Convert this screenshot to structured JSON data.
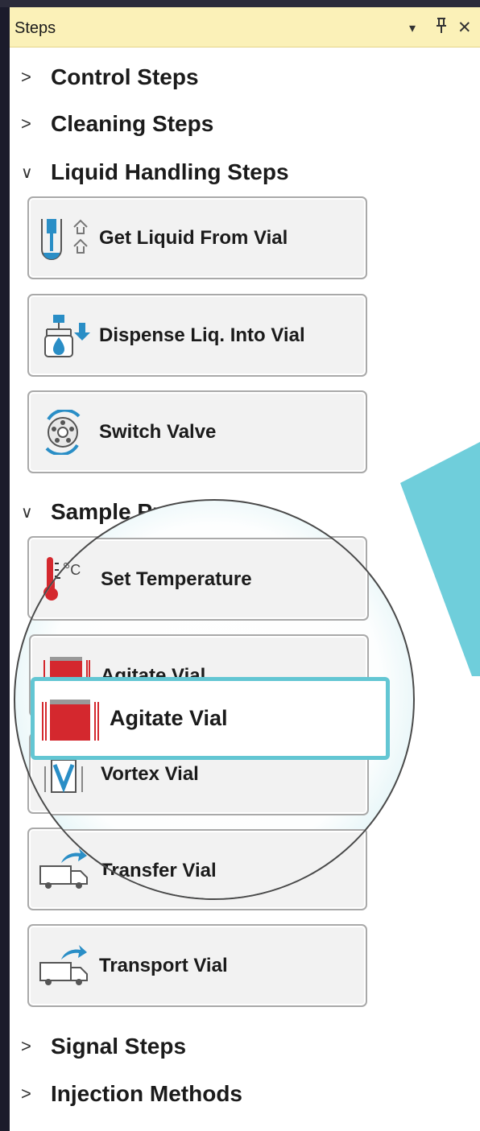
{
  "window": {
    "title": "Steps",
    "controls": {
      "dropdown": "▾",
      "pin": "ꟷ",
      "close": "✕"
    },
    "icons": {
      "dropdown": "chevron-down-icon",
      "pin": "pin-icon",
      "close": "close-icon"
    }
  },
  "categories": [
    {
      "label": "Control Steps",
      "expanded": false
    },
    {
      "label": "Cleaning Steps",
      "expanded": false
    },
    {
      "label": "Liquid Handling Steps",
      "expanded": true
    },
    {
      "label": "Sample Prep Steps",
      "expanded": true
    },
    {
      "label": "Signal Steps",
      "expanded": false
    },
    {
      "label": "Injection Methods",
      "expanded": false
    }
  ],
  "liquid_steps": [
    {
      "label": "Get Liquid From Vial",
      "icon": "syringe-up-icon"
    },
    {
      "label": "Dispense Liq. Into Vial",
      "icon": "dispense-icon"
    },
    {
      "label": "Switch Valve",
      "icon": "valve-icon"
    }
  ],
  "prep_steps": [
    {
      "label": "Set Temperature",
      "icon": "thermometer-icon"
    },
    {
      "label": "Agitate Vial",
      "icon": "agitate-icon"
    },
    {
      "label": "Vortex Vial",
      "icon": "vortex-icon"
    },
    {
      "label": "Transfer Vial",
      "icon": "truck-icon"
    },
    {
      "label": "Transport Vial",
      "icon": "truck-icon"
    }
  ],
  "highlight": {
    "label": "Agitate Vial",
    "icon": "agitate-icon"
  },
  "colors": {
    "accent": "#63c6d3",
    "teal": "#6fcedb",
    "title_bg": "#fbf1b8",
    "red": "#d4282e",
    "blue": "#2a8ec6"
  }
}
